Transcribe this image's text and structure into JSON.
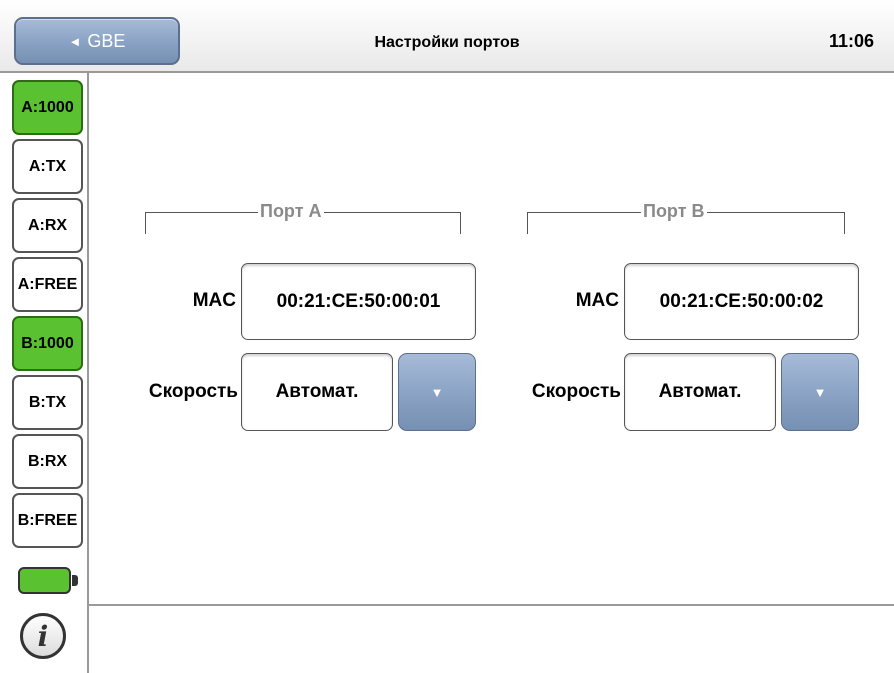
{
  "header": {
    "back_label": "GBE",
    "back_arrow": "◄",
    "title": "Настройки портов",
    "time": "11:06"
  },
  "sidebar": {
    "items": [
      {
        "label": "A:1000",
        "active": true
      },
      {
        "label": "A:TX",
        "active": false
      },
      {
        "label": "A:RX",
        "active": false
      },
      {
        "label": "A:FREE",
        "active": false
      },
      {
        "label": "B:1000",
        "active": true
      },
      {
        "label": "B:TX",
        "active": false
      },
      {
        "label": "B:RX",
        "active": false
      },
      {
        "label": "B:FREE",
        "active": false
      }
    ],
    "info_glyph": "i"
  },
  "ports": [
    {
      "group_label": "Порт А",
      "mac_label": "MAC",
      "mac_value": "00:21:CE:50:00:01",
      "speed_label": "Скорость",
      "speed_value": "Автомат.",
      "dropdown_glyph": "▼"
    },
    {
      "group_label": "Порт В",
      "mac_label": "MAC",
      "mac_value": "00:21:CE:50:00:02",
      "speed_label": "Скорость",
      "speed_value": "Автомат.",
      "dropdown_glyph": "▼"
    }
  ],
  "colors": {
    "active_green": "#5ac230",
    "button_blue": "#8ea6c7"
  },
  "battery_level": 1.0
}
